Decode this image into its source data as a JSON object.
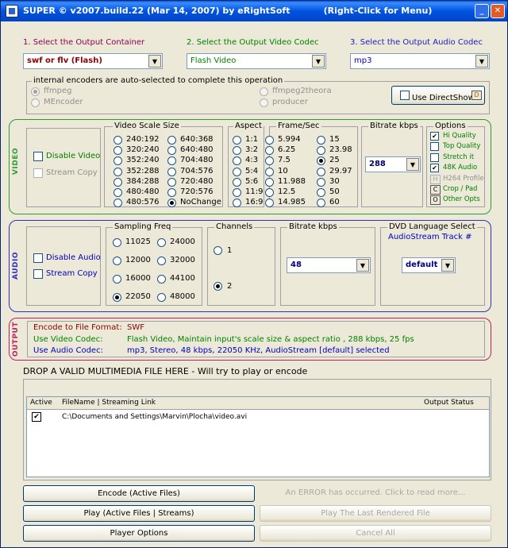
{
  "title": {
    "text": "SUPER © v2007.build.22 (Mar 14, 2007) by eRightSoft           (Right-Click for Menu)",
    "minimize_label": "_",
    "close_label": "✕"
  },
  "headers": {
    "container": "1.      Select the Output Container",
    "video_codec": "2.      Select the Output Video Codec",
    "audio_codec": "3.      Select the Output Audio Codec"
  },
  "selects": {
    "container": "swf or flv (Flash)",
    "video_codec": "Flash Video",
    "audio_codec": "mp3"
  },
  "encoders": {
    "title": "internal encoders are auto-selected to complete this operation",
    "options": [
      "ffmpeg",
      "MEncoder",
      "ffmpeg2theora",
      "producer"
    ],
    "selected": "ffmpeg",
    "directshow_label": "Use DirectShow",
    "directshow_icon_label": "D"
  },
  "video": {
    "section_label": "VIDEO",
    "disable_label": "Disable Video",
    "stream_copy_label": "Stream Copy",
    "scale_title": "Video Scale Size",
    "scale_col1": [
      "240:192",
      "320:240",
      "352:240",
      "352:288",
      "384:288",
      "480:480",
      "480:576"
    ],
    "scale_col2": [
      "640:368",
      "640:480",
      "704:480",
      "704:576",
      "720:480",
      "720:576",
      "NoChange"
    ],
    "scale_selected": "NoChange",
    "aspect_title": "Aspect",
    "aspects": [
      "1:1",
      "3:2",
      "4:3",
      "5:4",
      "5:6",
      "11:9",
      "16:9"
    ],
    "fps_title": "Frame/Sec",
    "fps_col1": [
      "5.994",
      "6.25",
      "7.5",
      "10",
      "11.988",
      "12.5",
      "14.985"
    ],
    "fps_col2": [
      "15",
      "23.98",
      "25",
      "29.97",
      "30",
      "50",
      "60"
    ],
    "fps_selected": "25",
    "bitrate_title": "Bitrate  kbps",
    "bitrate_value": "288",
    "options_title": "Options",
    "options": [
      {
        "label": "Hi Quality",
        "type": "check",
        "checked": true
      },
      {
        "label": "Top Quality",
        "type": "check",
        "checked": false
      },
      {
        "label": "Stretch it",
        "type": "check",
        "checked": false
      },
      {
        "label": "48K Audio",
        "type": "check",
        "checked": true
      },
      {
        "label": "H264 Profile",
        "type": "btn",
        "icon": "H",
        "disabled": true
      },
      {
        "label": "Crop / Pad",
        "type": "btn",
        "icon": "C",
        "disabled": false
      },
      {
        "label": "Other Opts",
        "type": "btn",
        "icon": "O",
        "disabled": false
      }
    ]
  },
  "audio": {
    "section_label": "AUDIO",
    "disable_label": "Disable Audio",
    "stream_copy_label": "Stream Copy",
    "freq_title": "Sampling Freq",
    "freq_col1": [
      "11025",
      "12000",
      "16000",
      "22050"
    ],
    "freq_col2": [
      "24000",
      "32000",
      "44100",
      "48000"
    ],
    "freq_selected": "22050",
    "channels_title": "Channels",
    "channels": [
      "1",
      "2"
    ],
    "channels_selected": "2",
    "bitrate_title": "Bitrate  kbps",
    "bitrate_value": "48",
    "dvd_title": "DVD Language Select",
    "dvd_subtitle": "AudioStream  Track #",
    "dvd_value": "default"
  },
  "output": {
    "section_label": "OUTPUT",
    "rows": [
      {
        "label": "Encode to File Format:",
        "value": "SWF"
      },
      {
        "label": "Use Video Codec:",
        "value": "Flash Video,  Maintain input's scale size & aspect ratio ,  288 kbps,  25 fps"
      },
      {
        "label": "Use Audio Codec:",
        "value": "mp3,  Stereo,  48 kbps,  22050 KHz,  AudioStream [default] selected"
      }
    ]
  },
  "drop_hint": "DROP A VALID MULTIMEDIA FILE HERE - Will try to play or encode",
  "file_list": {
    "columns": [
      "Active",
      "FileName  |  Streaming Link",
      "Output Status"
    ],
    "rows": [
      {
        "active": true,
        "file": "C:\\Documents and Settings\\Marvin\\Plocha\\video.avi",
        "status": ""
      }
    ]
  },
  "buttons": {
    "encode": "Encode (Active Files)",
    "error": "An ERROR has occurred. Click to read more...",
    "play": "Play (Active Files | Streams)",
    "play_last": "Play The Last Rendered File",
    "player_options": "Player Options",
    "cancel_all": "Cancel All"
  },
  "colors": {
    "video_border": "#2e9c2e",
    "audio_border": "#3030c0",
    "output_border": "#c02060"
  }
}
